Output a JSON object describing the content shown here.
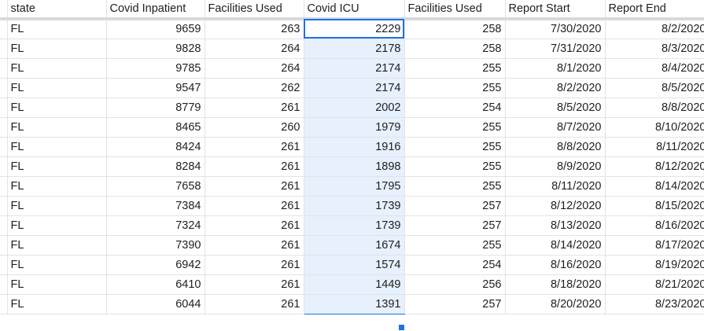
{
  "sheet": {
    "columns": [
      "state",
      "Covid Inpatient",
      "Facilities Used",
      "Covid ICU",
      "Facilities Used",
      "Report Start",
      "Report End"
    ],
    "rows": [
      [
        "FL",
        "9659",
        "263",
        "2229",
        "258",
        "7/30/2020",
        "8/2/2020"
      ],
      [
        "FL",
        "9828",
        "264",
        "2178",
        "258",
        "7/31/2020",
        "8/3/2020"
      ],
      [
        "FL",
        "9785",
        "264",
        "2174",
        "255",
        "8/1/2020",
        "8/4/2020"
      ],
      [
        "FL",
        "9547",
        "262",
        "2174",
        "255",
        "8/2/2020",
        "8/5/2020"
      ],
      [
        "FL",
        "8779",
        "261",
        "2002",
        "254",
        "8/5/2020",
        "8/8/2020"
      ],
      [
        "FL",
        "8465",
        "260",
        "1979",
        "255",
        "8/7/2020",
        "8/10/2020"
      ],
      [
        "FL",
        "8424",
        "261",
        "1916",
        "255",
        "8/8/2020",
        "8/11/2020"
      ],
      [
        "FL",
        "8284",
        "261",
        "1898",
        "255",
        "8/9/2020",
        "8/12/2020"
      ],
      [
        "FL",
        "7658",
        "261",
        "1795",
        "255",
        "8/11/2020",
        "8/14/2020"
      ],
      [
        "FL",
        "7384",
        "261",
        "1739",
        "257",
        "8/12/2020",
        "8/15/2020"
      ],
      [
        "FL",
        "7324",
        "261",
        "1739",
        "257",
        "8/13/2020",
        "8/16/2020"
      ],
      [
        "FL",
        "7390",
        "261",
        "1674",
        "255",
        "8/14/2020",
        "8/17/2020"
      ],
      [
        "FL",
        "6942",
        "261",
        "1574",
        "254",
        "8/16/2020",
        "8/19/2020"
      ],
      [
        "FL",
        "6410",
        "261",
        "1449",
        "256",
        "8/18/2020",
        "8/21/2020"
      ],
      [
        "FL",
        "6044",
        "261",
        "1391",
        "257",
        "8/20/2020",
        "8/23/2020"
      ]
    ],
    "selected_column": 3,
    "active_row": 0,
    "colors": {
      "selection_fill": "#e7f0fd",
      "selection_border": "#1a73e8",
      "gridline": "#e2e3e3",
      "header_divider": "#d7d9dc"
    }
  }
}
